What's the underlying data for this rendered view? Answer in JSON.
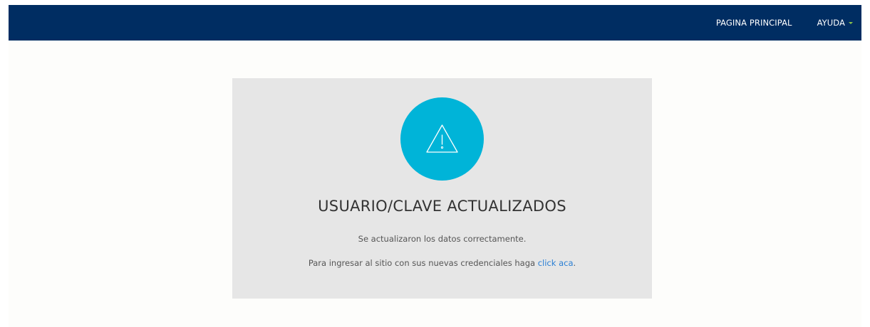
{
  "nav": {
    "home_label": "PAGINA PRINCIPAL",
    "help_label": "AYUDA"
  },
  "message": {
    "icon": "warning-icon",
    "title": "USUARIO/CLAVE ACTUALIZADOS",
    "line1": "Se actualizaron los datos correctamente.",
    "line2_prefix": "Para ingresar al sitio con sus nuevas credenciales haga",
    "link_label": "click aca",
    "line2_suffix": "."
  },
  "colors": {
    "header_bg": "#002d62",
    "circle": "#00b4d8",
    "card_bg": "#e6e6e6",
    "link": "#2a7fd4",
    "caret": "#8bc34a"
  }
}
